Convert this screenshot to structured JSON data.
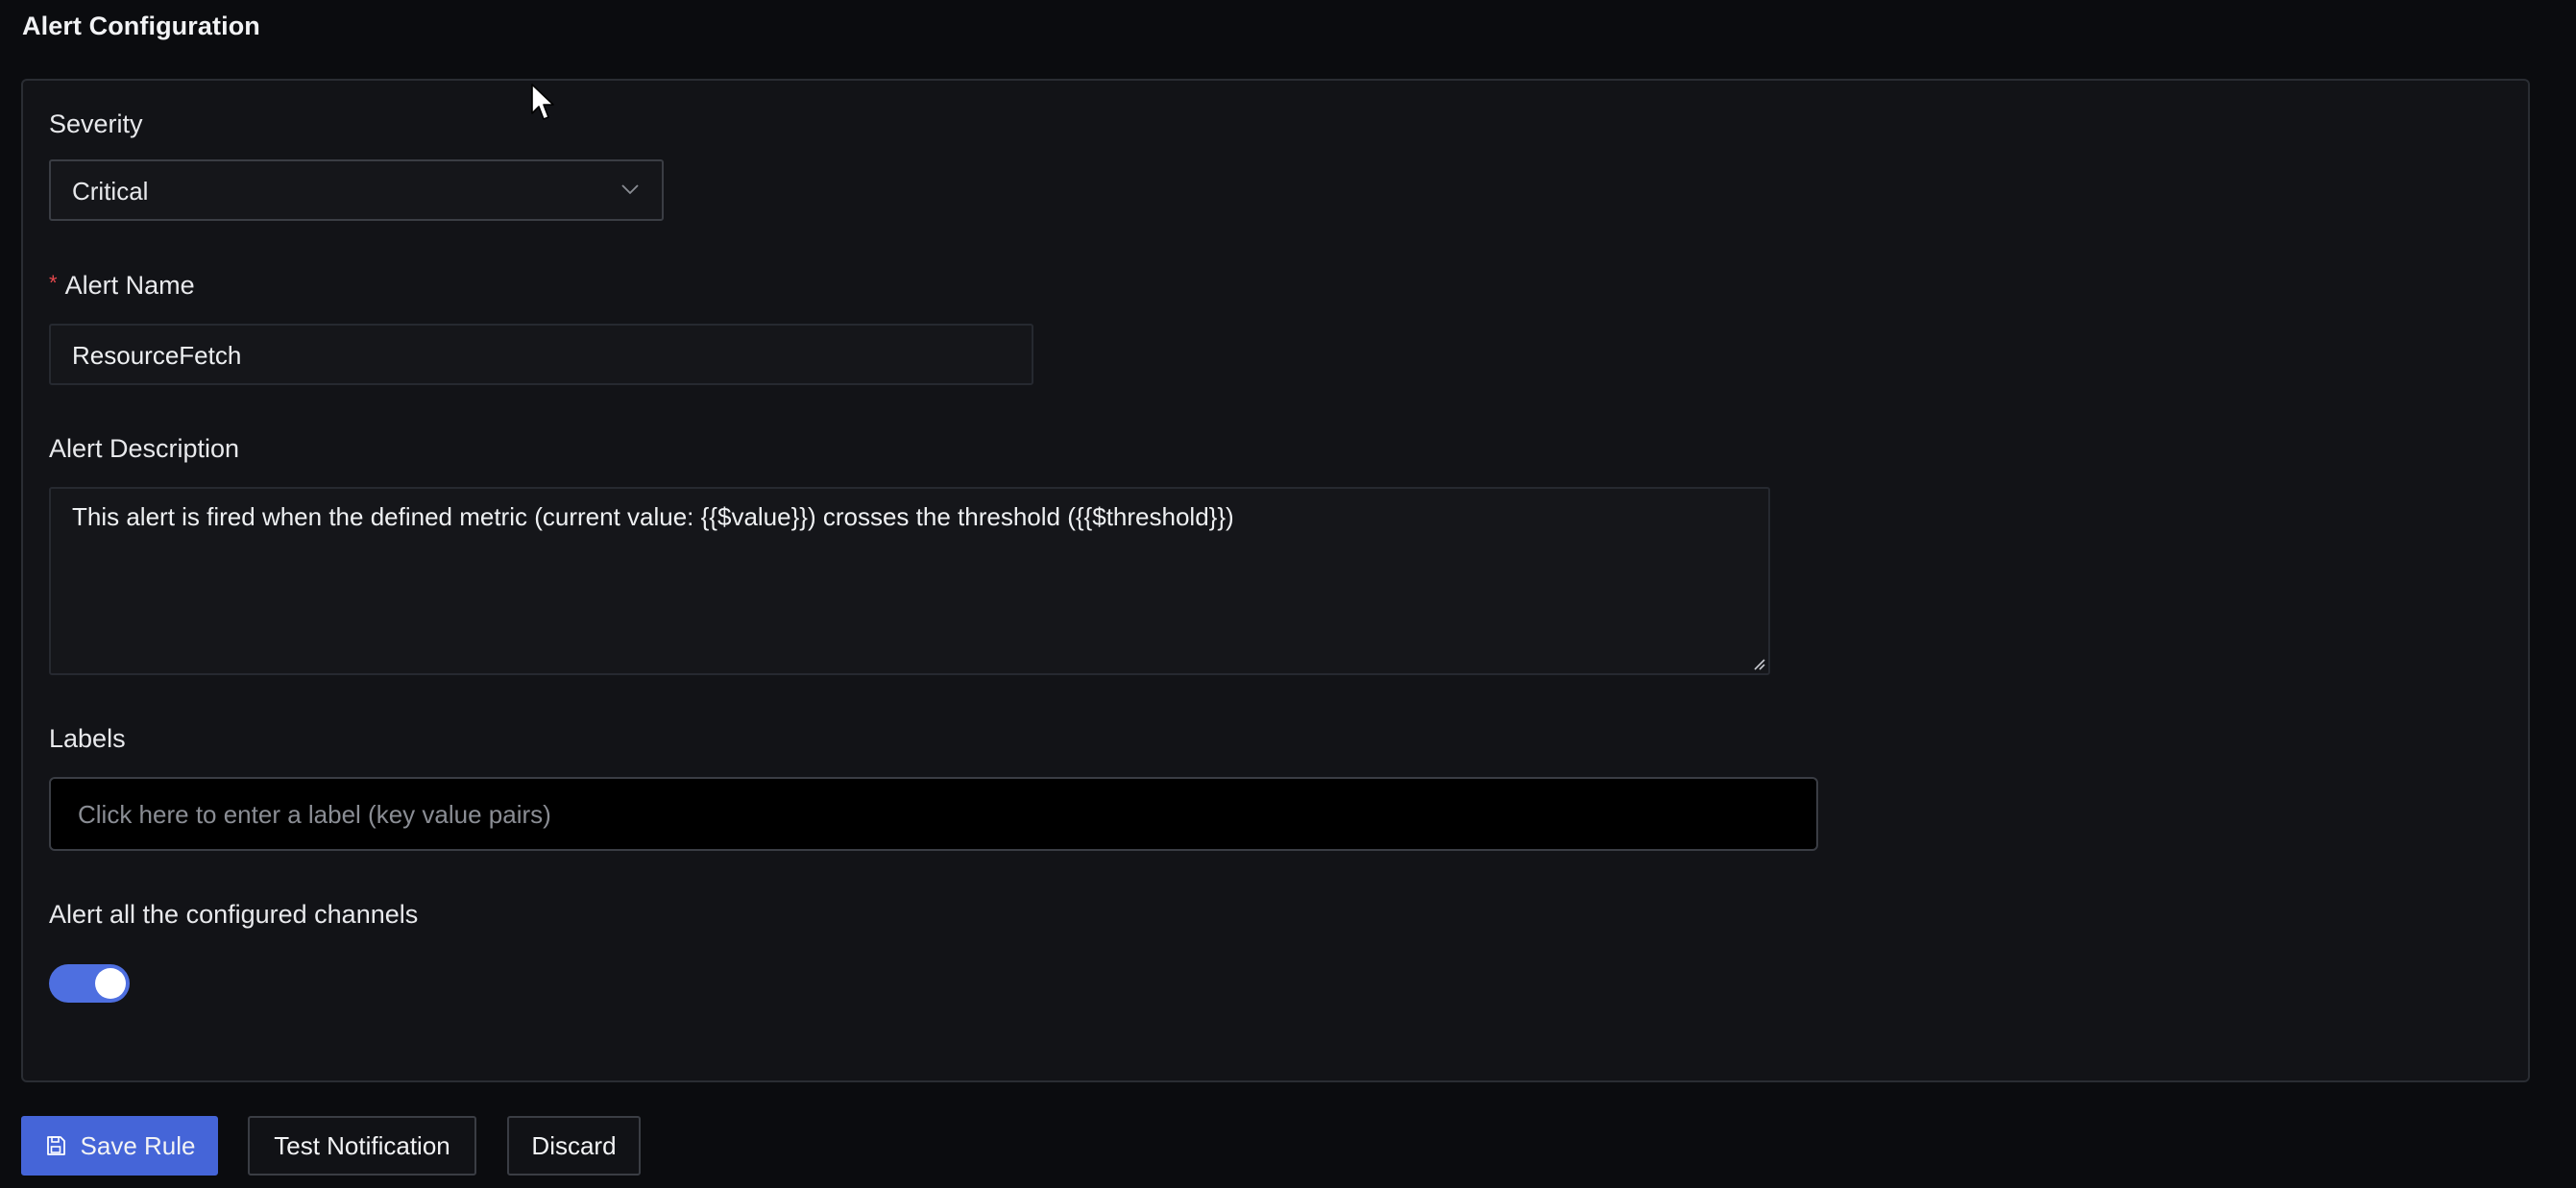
{
  "page": {
    "title": "Alert Configuration"
  },
  "form": {
    "severity": {
      "label": "Severity",
      "value": "Critical"
    },
    "alert_name": {
      "required_mark": "*",
      "label": "Alert Name",
      "value": "ResourceFetch"
    },
    "alert_description": {
      "label": "Alert Description",
      "value": "This alert is fired when the defined metric (current value: {{$value}}) crosses the threshold ({{$threshold}})"
    },
    "labels": {
      "label": "Labels",
      "placeholder": "Click here to enter a label (key value pairs)"
    },
    "alert_all_channels": {
      "label": "Alert all the configured channels",
      "enabled": true
    }
  },
  "actions": {
    "save_label": "Save Rule",
    "test_label": "Test Notification",
    "discard_label": "Discard"
  },
  "icons": {
    "severity_dropdown": "chevron-down-icon",
    "save": "save-icon",
    "textarea_resize": "resize-handle-icon"
  },
  "colors": {
    "primary": "#4565d8",
    "toggle_on": "#4e6fe0",
    "required": "#e5484d",
    "background": "#0b0c0f",
    "card": "#121317"
  }
}
